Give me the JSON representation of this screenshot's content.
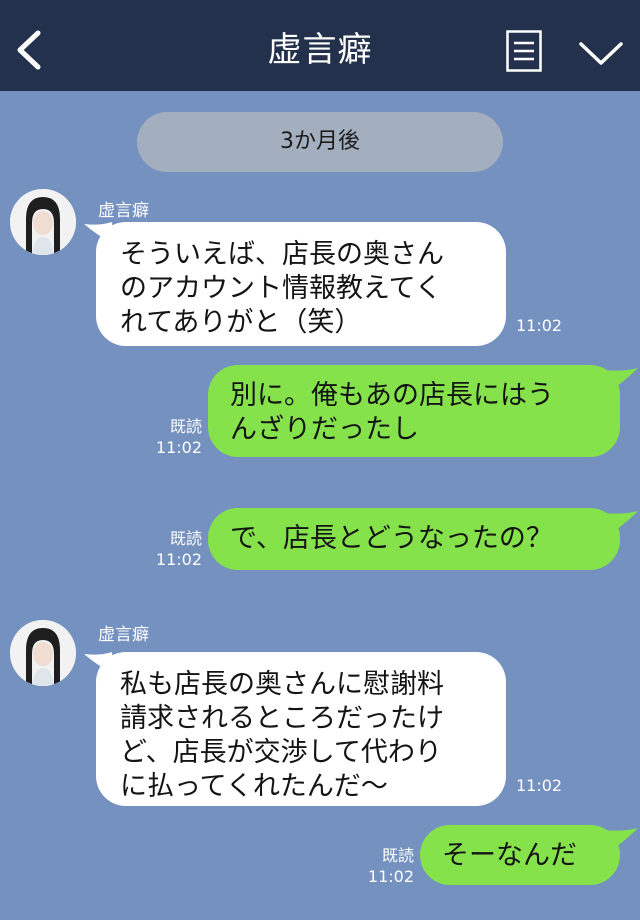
{
  "header": {
    "title": "虚言癖"
  },
  "date_separator": "3か月後",
  "messages": [
    {
      "side": "left",
      "sender": "虚言癖",
      "lines": [
        "そういえば、店長の奥さん",
        "のアカウント情報教えてく",
        "れてありがと（笑）"
      ],
      "time": "11:02"
    },
    {
      "side": "right",
      "read": "既読",
      "time": "11:02",
      "lines": [
        "別に。俺もあの店長にはう",
        "んざりだったし"
      ]
    },
    {
      "side": "right",
      "read": "既読",
      "time": "11:02",
      "lines": [
        "で、店長とどうなったの？"
      ]
    },
    {
      "side": "left",
      "sender": "虚言癖",
      "lines": [
        "私も店長の奥さんに慰謝料",
        "請求されるところだったけ",
        "ど、店長が交渉して代わり",
        "に払ってくれたんだ〜"
      ],
      "time": "11:02"
    },
    {
      "side": "right",
      "read": "既読",
      "time": "11:02",
      "lines": [
        "そーなんだ"
      ]
    }
  ],
  "colors": {
    "header_bg": "#23314d",
    "chat_bg": "#7591c0",
    "incoming_bubble": "#ffffff",
    "outgoing_bubble": "#85e24b",
    "date_pill": "#a3aebf"
  },
  "icons": [
    "back-icon",
    "menu-icon",
    "chevron-down-icon"
  ]
}
